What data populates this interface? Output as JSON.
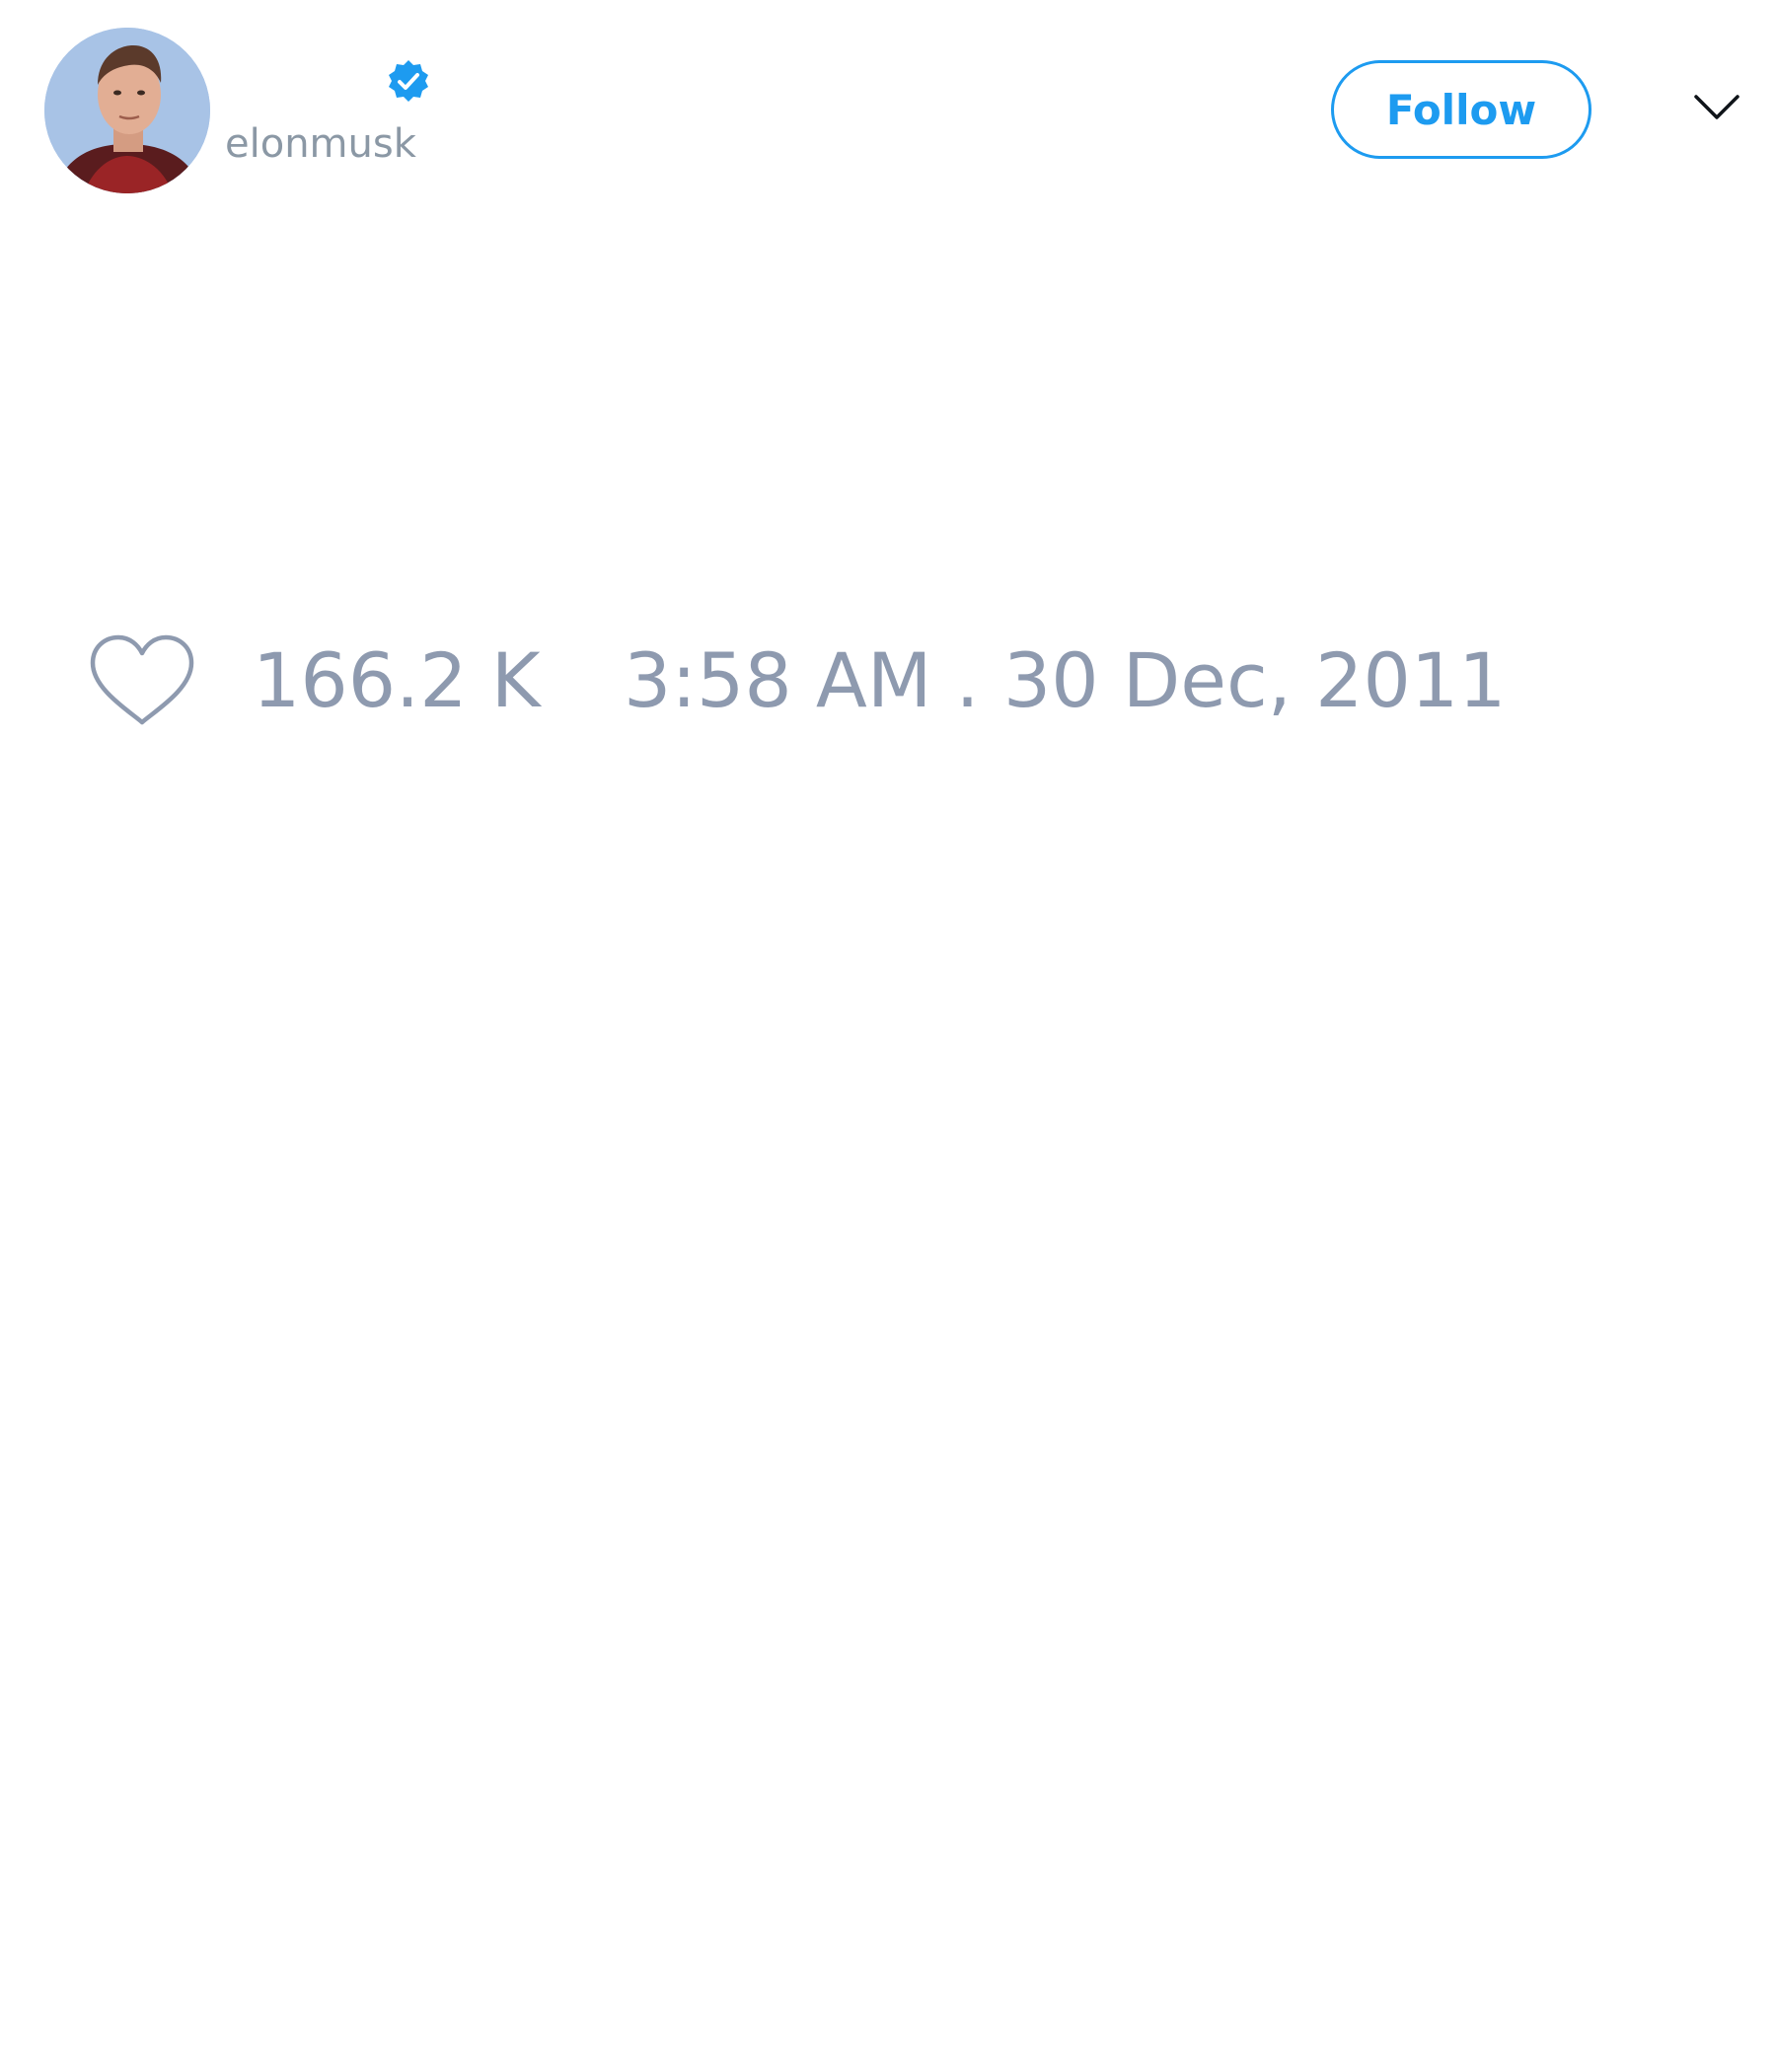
{
  "header": {
    "display_name": "",
    "handle": "elonmusk",
    "verified": true,
    "follow_label": "Follow",
    "more_menu_icon": "chevron-down-icon"
  },
  "avatar": {
    "icon": "profile-photo"
  },
  "stats": {
    "like_icon": "heart-icon",
    "like_count": "166.2 K",
    "timestamp": "3:58 AM . 30 Dec, 2011"
  },
  "colors": {
    "accent": "#1d9bf0",
    "muted_text": "#8e9aaf",
    "background": "#ffffff",
    "chevron": "#0f1419"
  }
}
